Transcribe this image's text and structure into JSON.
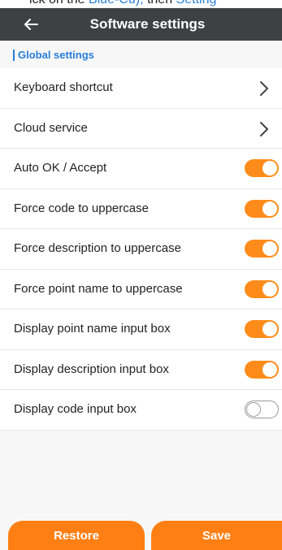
{
  "top_strip": {
    "text_prefix": "ick on the ",
    "text_link1": "Blue-Cu),",
    "text_middle": " then ",
    "text_link2": "Setting"
  },
  "header": {
    "title": "Software settings",
    "back_icon": "arrow-left-icon"
  },
  "section": {
    "label": "Global settings"
  },
  "rows": [
    {
      "label": "Keyboard shortcut",
      "type": "link"
    },
    {
      "label": "Cloud service",
      "type": "link"
    },
    {
      "label": "Auto OK / Accept",
      "type": "toggle",
      "on": true
    },
    {
      "label": "Force code to uppercase",
      "type": "toggle",
      "on": true
    },
    {
      "label": "Force description to uppercase",
      "type": "toggle",
      "on": true
    },
    {
      "label": "Force point name to uppercase",
      "type": "toggle",
      "on": true
    },
    {
      "label": "Display point name input box",
      "type": "toggle",
      "on": true
    },
    {
      "label": "Display description input box",
      "type": "toggle",
      "on": true
    },
    {
      "label": "Display code input box",
      "type": "toggle",
      "on": false
    }
  ],
  "buttons": {
    "restore": "Restore",
    "save": "Save"
  },
  "colors": {
    "header_bg": "#3e4043",
    "accent_blue": "#2a7ed8",
    "accent_orange": "#ff8c1a"
  }
}
